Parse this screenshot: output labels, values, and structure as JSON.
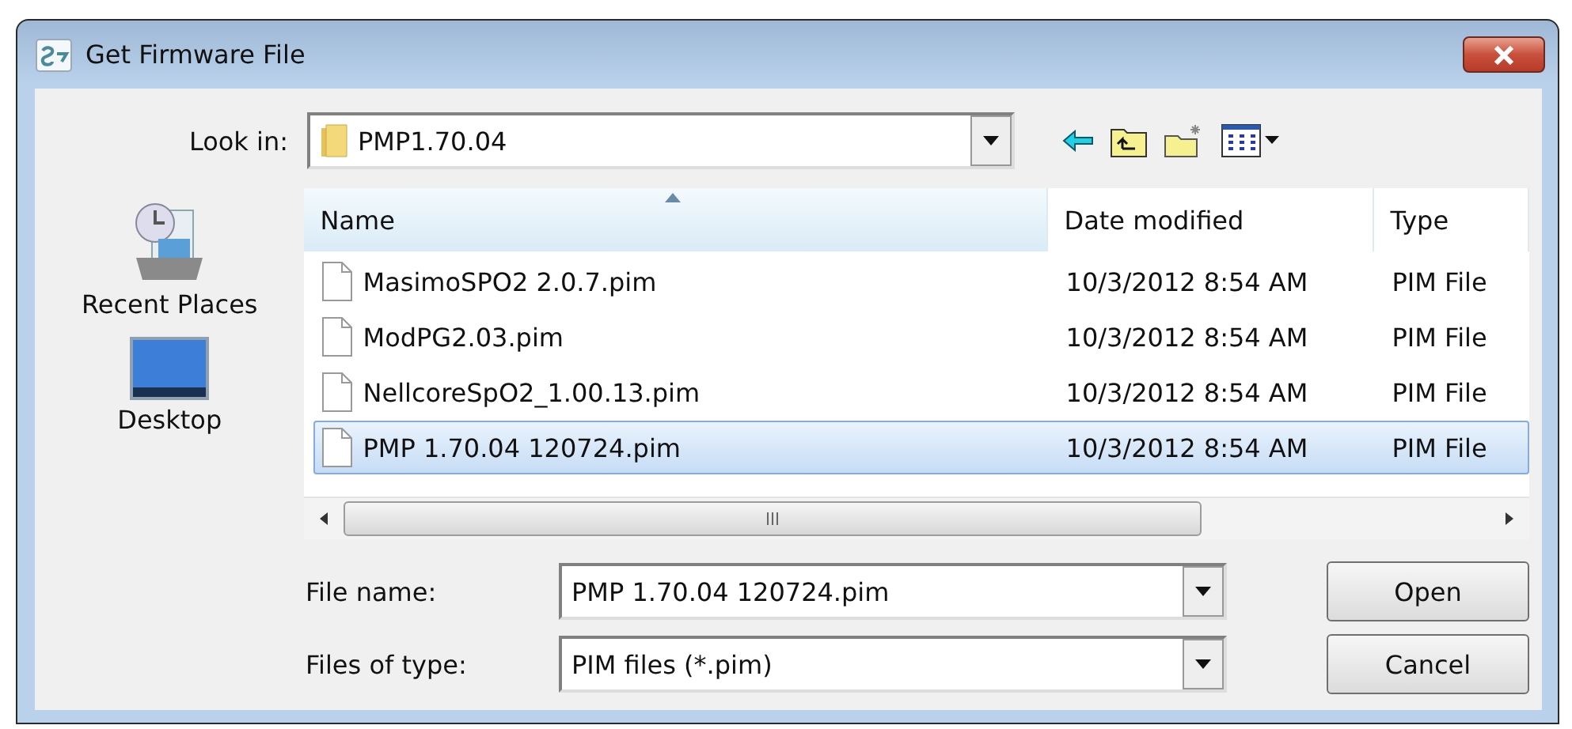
{
  "window": {
    "title": "Get Firmware File"
  },
  "look_in": {
    "label": "Look in:",
    "value": "PMP1.70.04"
  },
  "places": [
    {
      "label": "Recent Places",
      "kind": "recent"
    },
    {
      "label": "Desktop",
      "kind": "desktop"
    }
  ],
  "table": {
    "columns": [
      "Name",
      "Date modified",
      "Type"
    ],
    "rows": [
      {
        "name": "MasimoSPO2 2.0.7.pim",
        "date": "10/3/2012 8:54 AM",
        "type": "PIM File",
        "selected": false
      },
      {
        "name": "ModPG2.03.pim",
        "date": "10/3/2012 8:54 AM",
        "type": "PIM File",
        "selected": false
      },
      {
        "name": "NellcoreSpO2_1.00.13.pim",
        "date": "10/3/2012 8:54 AM",
        "type": "PIM File",
        "selected": false
      },
      {
        "name": "PMP 1.70.04 120724.pim",
        "date": "10/3/2012 8:54 AM",
        "type": "PIM File",
        "selected": true
      }
    ]
  },
  "file_name": {
    "label": "File name:",
    "value": "PMP 1.70.04 120724.pim"
  },
  "file_type": {
    "label": "Files of type:",
    "value": "PIM files (*.pim)"
  },
  "buttons": [
    "Open",
    "Cancel"
  ]
}
